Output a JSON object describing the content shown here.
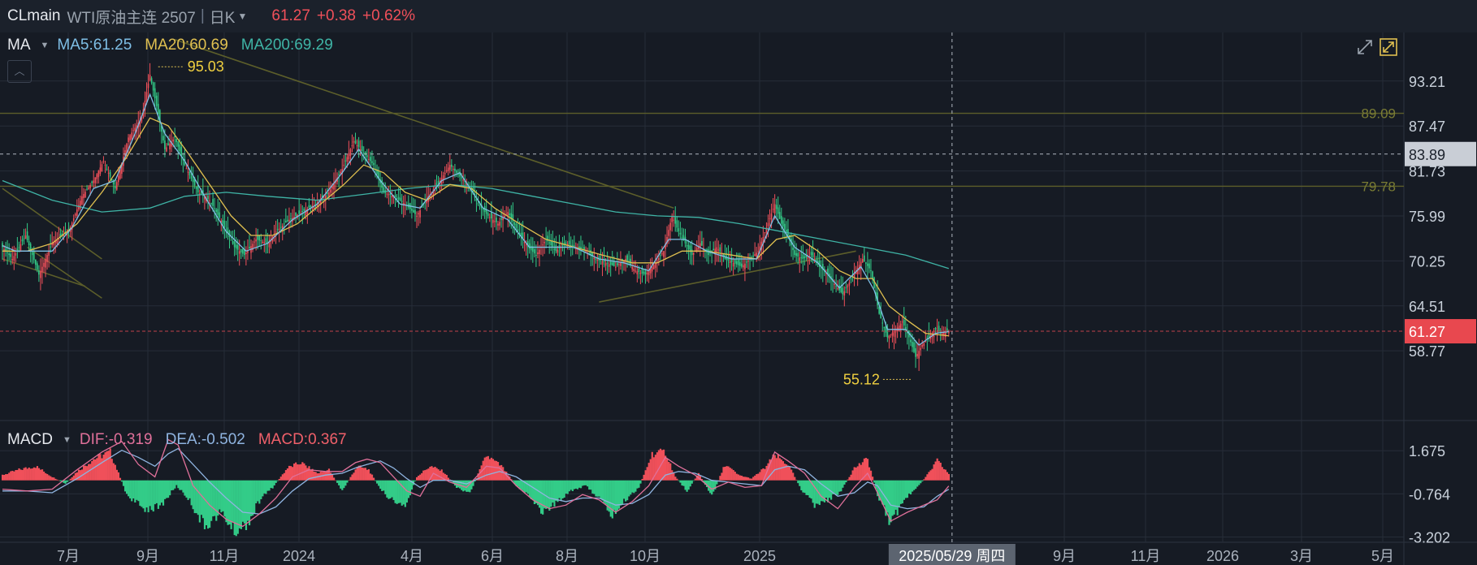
{
  "header": {
    "symbol": "CLmain",
    "name": "WTI原油主连 2507",
    "period": "日K",
    "price": "61.27",
    "change": "+0.38",
    "change_pct": "+0.62%"
  },
  "main_legend": {
    "label": "MA",
    "ma5": "MA5:61.25",
    "ma20": "MA20:60.69",
    "ma200": "MA200:69.29"
  },
  "macd_legend": {
    "label": "MACD",
    "dif": "DIF:-0.319",
    "dea": "DEA:-0.502",
    "macd": "MACD:0.367"
  },
  "colors": {
    "up": "#f0505a",
    "down": "#33cc88",
    "ma5": "#7fbfe6",
    "ma20": "#e0c050",
    "ma200": "#3fb4a6",
    "dif": "#e0709a",
    "dea": "#8fb4e0",
    "background": "#161b24"
  },
  "chart_data": {
    "type": "candlestick",
    "price_axis": {
      "ticks": [
        "93.21",
        "87.47",
        "81.73",
        "75.99",
        "70.25",
        "64.51",
        "58.77"
      ]
    },
    "price_range": [
      50.5,
      99.2
    ],
    "current_price_label": "61.27",
    "crosshair_price_label": "83.89",
    "horizontal_levels": [
      {
        "label": "89.09",
        "value": 89.09
      },
      {
        "label": "79.78",
        "value": 79.78
      }
    ],
    "annotations": [
      {
        "label": "95.03",
        "value": 95.03,
        "type": "high"
      },
      {
        "label": "55.12",
        "value": 55.12,
        "type": "low"
      }
    ],
    "time_axis": {
      "labels": [
        "7月",
        "9月",
        "11月",
        "2024",
        "4月",
        "6月",
        "8月",
        "10月",
        "2025",
        "9月",
        "11月",
        "2026",
        "3月",
        "5月"
      ],
      "crosshair_date": "2025/05/29 周四"
    },
    "macd_axis": {
      "ticks": [
        "1.675",
        "-0.764",
        "-3.202"
      ],
      "range": [
        -3.5,
        3.2
      ]
    },
    "close_path": [
      [
        0,
        72.0
      ],
      [
        6,
        70.5
      ],
      [
        14,
        73.5
      ],
      [
        22,
        68.5
      ],
      [
        30,
        72.5
      ],
      [
        40,
        74.0
      ],
      [
        48,
        78.5
      ],
      [
        55,
        80.5
      ],
      [
        61,
        83.0
      ],
      [
        68,
        79.5
      ],
      [
        76,
        86.0
      ],
      [
        84,
        88.5
      ],
      [
        89,
        94.0
      ],
      [
        94,
        89.0
      ],
      [
        98,
        84.5
      ],
      [
        104,
        86.0
      ],
      [
        110,
        82.5
      ],
      [
        118,
        79.0
      ],
      [
        125,
        78.0
      ],
      [
        133,
        75.0
      ],
      [
        140,
        72.0
      ],
      [
        146,
        71.0
      ],
      [
        153,
        73.0
      ],
      [
        160,
        72.5
      ],
      [
        165,
        74.0
      ],
      [
        173,
        75.5
      ],
      [
        181,
        76.5
      ],
      [
        189,
        77.5
      ],
      [
        197,
        79.0
      ],
      [
        205,
        82.0
      ],
      [
        212,
        85.5
      ],
      [
        218,
        84.0
      ],
      [
        224,
        82.5
      ],
      [
        230,
        79.0
      ],
      [
        236,
        78.5
      ],
      [
        243,
        77.5
      ],
      [
        250,
        76.0
      ],
      [
        257,
        78.5
      ],
      [
        264,
        80.5
      ],
      [
        270,
        82.5
      ],
      [
        276,
        81.0
      ],
      [
        281,
        80.0
      ],
      [
        287,
        77.5
      ],
      [
        293,
        76.0
      ],
      [
        299,
        75.0
      ],
      [
        305,
        76.5
      ],
      [
        311,
        74.0
      ],
      [
        317,
        72.0
      ],
      [
        322,
        71.0
      ],
      [
        328,
        73.0
      ],
      [
        334,
        71.5
      ],
      [
        340,
        72.5
      ],
      [
        346,
        72.0
      ],
      [
        352,
        71.5
      ],
      [
        358,
        70.5
      ],
      [
        364,
        70.0
      ],
      [
        370,
        69.5
      ],
      [
        376,
        70.5
      ],
      [
        382,
        69.0
      ],
      [
        388,
        68.5
      ],
      [
        394,
        70.0
      ],
      [
        399,
        71.5
      ],
      [
        404,
        76.0
      ],
      [
        408,
        74.0
      ],
      [
        412,
        72.5
      ],
      [
        416,
        71.0
      ],
      [
        421,
        72.5
      ],
      [
        426,
        71.0
      ],
      [
        431,
        72.0
      ],
      [
        436,
        70.5
      ],
      [
        441,
        70.0
      ],
      [
        446,
        69.5
      ],
      [
        451,
        70.5
      ],
      [
        456,
        71.5
      ],
      [
        461,
        74.5
      ],
      [
        466,
        77.5
      ],
      [
        470,
        75.0
      ],
      [
        474,
        73.5
      ],
      [
        478,
        71.0
      ],
      [
        483,
        70.5
      ],
      [
        488,
        71.0
      ],
      [
        493,
        69.5
      ],
      [
        498,
        68.5
      ],
      [
        503,
        67.0
      ],
      [
        507,
        66.0
      ],
      [
        511,
        67.5
      ],
      [
        515,
        69.0
      ],
      [
        519,
        70.5
      ],
      [
        524,
        69.0
      ],
      [
        529,
        63.5
      ],
      [
        534,
        60.5
      ],
      [
        539,
        61.5
      ],
      [
        543,
        62.5
      ],
      [
        547,
        60.5
      ],
      [
        551,
        58.0
      ],
      [
        555,
        59.5
      ],
      [
        559,
        60.5
      ],
      [
        563,
        61.5
      ],
      [
        567,
        61.0
      ],
      [
        571,
        61.27
      ]
    ],
    "ma5_path": [
      [
        0,
        72.2
      ],
      [
        8,
        71.5
      ],
      [
        18,
        71.5
      ],
      [
        30,
        71.5
      ],
      [
        42,
        74.5
      ],
      [
        55,
        79.5
      ],
      [
        68,
        80.5
      ],
      [
        80,
        86.5
      ],
      [
        89,
        91.5
      ],
      [
        98,
        86.5
      ],
      [
        110,
        83.0
      ],
      [
        122,
        78.5
      ],
      [
        135,
        74.0
      ],
      [
        147,
        71.5
      ],
      [
        160,
        72.5
      ],
      [
        175,
        75.5
      ],
      [
        190,
        77.5
      ],
      [
        205,
        81.5
      ],
      [
        215,
        84.5
      ],
      [
        228,
        80.5
      ],
      [
        240,
        77.5
      ],
      [
        252,
        77.0
      ],
      [
        265,
        80.5
      ],
      [
        276,
        81.5
      ],
      [
        290,
        77.0
      ],
      [
        305,
        75.5
      ],
      [
        318,
        72.0
      ],
      [
        330,
        72.0
      ],
      [
        345,
        72.0
      ],
      [
        360,
        70.5
      ],
      [
        375,
        70.0
      ],
      [
        390,
        69.0
      ],
      [
        402,
        73.0
      ],
      [
        412,
        73.0
      ],
      [
        425,
        71.5
      ],
      [
        440,
        70.5
      ],
      [
        455,
        70.5
      ],
      [
        466,
        76.0
      ],
      [
        478,
        72.0
      ],
      [
        492,
        70.0
      ],
      [
        505,
        66.8
      ],
      [
        518,
        69.5
      ],
      [
        526,
        66.5
      ],
      [
        534,
        61.5
      ],
      [
        545,
        61.5
      ],
      [
        553,
        59.5
      ],
      [
        563,
        61.0
      ],
      [
        571,
        61.25
      ]
    ],
    "ma20_path": [
      [
        0,
        71.5
      ],
      [
        15,
        71.5
      ],
      [
        30,
        72.5
      ],
      [
        45,
        75.0
      ],
      [
        60,
        79.0
      ],
      [
        75,
        83.5
      ],
      [
        89,
        88.5
      ],
      [
        100,
        87.5
      ],
      [
        112,
        84.0
      ],
      [
        125,
        80.0
      ],
      [
        138,
        76.0
      ],
      [
        150,
        73.5
      ],
      [
        163,
        73.5
      ],
      [
        178,
        75.0
      ],
      [
        192,
        77.5
      ],
      [
        206,
        80.0
      ],
      [
        218,
        82.5
      ],
      [
        230,
        81.5
      ],
      [
        243,
        79.0
      ],
      [
        256,
        78.0
      ],
      [
        270,
        80.0
      ],
      [
        283,
        79.5
      ],
      [
        297,
        77.0
      ],
      [
        312,
        75.0
      ],
      [
        328,
        73.0
      ],
      [
        345,
        72.0
      ],
      [
        362,
        71.0
      ],
      [
        380,
        70.0
      ],
      [
        395,
        70.0
      ],
      [
        410,
        71.5
      ],
      [
        425,
        71.5
      ],
      [
        440,
        71.0
      ],
      [
        455,
        70.5
      ],
      [
        467,
        73.0
      ],
      [
        478,
        73.5
      ],
      [
        492,
        71.5
      ],
      [
        505,
        69.0
      ],
      [
        515,
        68.0
      ],
      [
        525,
        68.0
      ],
      [
        535,
        64.5
      ],
      [
        547,
        62.5
      ],
      [
        557,
        61.0
      ],
      [
        566,
        60.8
      ],
      [
        571,
        60.69
      ]
    ],
    "ma200_path": [
      [
        0,
        80.5
      ],
      [
        30,
        78.0
      ],
      [
        60,
        76.5
      ],
      [
        89,
        77.0
      ],
      [
        110,
        78.5
      ],
      [
        135,
        79.0
      ],
      [
        160,
        78.5
      ],
      [
        190,
        78.0
      ],
      [
        220,
        78.8
      ],
      [
        245,
        79.5
      ],
      [
        270,
        80.0
      ],
      [
        295,
        79.5
      ],
      [
        320,
        78.5
      ],
      [
        345,
        77.5
      ],
      [
        370,
        76.5
      ],
      [
        395,
        76.0
      ],
      [
        420,
        75.8
      ],
      [
        445,
        75.0
      ],
      [
        470,
        74.0
      ],
      [
        495,
        73.0
      ],
      [
        520,
        72.0
      ],
      [
        545,
        71.0
      ],
      [
        560,
        70.0
      ],
      [
        571,
        69.29
      ]
    ],
    "trend_lines": [
      {
        "from": [
          104,
          98.5
        ],
        "to": [
          405,
          77.0
        ]
      },
      {
        "from": [
          0,
          79.5
        ],
        "to": [
          60,
          70.5
        ]
      },
      {
        "from": [
          360,
          65.0
        ],
        "to": [
          515,
          71.5
        ]
      },
      {
        "from": [
          15,
          72.0
        ],
        "to": [
          60,
          65.5
        ]
      },
      {
        "from": [
          0,
          70.5
        ],
        "to": [
          50,
          67.0
        ]
      }
    ],
    "macd_hist_path": [
      [
        0,
        0.3
      ],
      [
        10,
        0.6
      ],
      [
        20,
        0.8
      ],
      [
        30,
        0.2
      ],
      [
        38,
        -0.2
      ],
      [
        45,
        0.5
      ],
      [
        55,
        1.2
      ],
      [
        65,
        1.6
      ],
      [
        75,
        -0.8
      ],
      [
        85,
        -1.6
      ],
      [
        95,
        -1.5
      ],
      [
        105,
        -0.3
      ],
      [
        112,
        -1.0
      ],
      [
        122,
        -2.6
      ],
      [
        132,
        -1.8
      ],
      [
        140,
        -2.9
      ],
      [
        148,
        -2.4
      ],
      [
        156,
        -1.0
      ],
      [
        163,
        -0.4
      ],
      [
        172,
        0.7
      ],
      [
        180,
        1.0
      ],
      [
        190,
        0.4
      ],
      [
        197,
        0.6
      ],
      [
        205,
        -0.6
      ],
      [
        214,
        0.8
      ],
      [
        221,
        0.6
      ],
      [
        228,
        -0.5
      ],
      [
        236,
        -1.2
      ],
      [
        243,
        -1.5
      ],
      [
        250,
        0.2
      ],
      [
        258,
        0.8
      ],
      [
        266,
        0.5
      ],
      [
        274,
        -0.4
      ],
      [
        282,
        -0.7
      ],
      [
        292,
        1.4
      ],
      [
        301,
        0.8
      ],
      [
        310,
        -0.3
      ],
      [
        318,
        -0.9
      ],
      [
        326,
        -1.8
      ],
      [
        334,
        -1.3
      ],
      [
        342,
        -0.6
      ],
      [
        352,
        -0.3
      ],
      [
        360,
        -1.0
      ],
      [
        368,
        -2.0
      ],
      [
        376,
        -1.1
      ],
      [
        384,
        -0.4
      ],
      [
        392,
        1.5
      ],
      [
        400,
        1.6
      ],
      [
        406,
        0.2
      ],
      [
        413,
        -0.6
      ],
      [
        420,
        0.4
      ],
      [
        428,
        -0.9
      ],
      [
        436,
        0.9
      ],
      [
        444,
        0.3
      ],
      [
        452,
        0.1
      ],
      [
        460,
        0.7
      ],
      [
        466,
        1.4
      ],
      [
        474,
        0.9
      ],
      [
        482,
        -0.5
      ],
      [
        490,
        -1.4
      ],
      [
        498,
        -1.1
      ],
      [
        506,
        -0.6
      ],
      [
        514,
        0.7
      ],
      [
        522,
        1.2
      ],
      [
        528,
        -0.8
      ],
      [
        536,
        -2.4
      ],
      [
        544,
        -1.1
      ],
      [
        552,
        -0.4
      ],
      [
        558,
        0.3
      ],
      [
        564,
        1.1
      ],
      [
        571,
        0.367
      ]
    ],
    "dif_path": [
      [
        0,
        -0.5
      ],
      [
        15,
        -0.6
      ],
      [
        30,
        -0.5
      ],
      [
        45,
        0.6
      ],
      [
        60,
        1.6
      ],
      [
        72,
        2.2
      ],
      [
        82,
        0.9
      ],
      [
        92,
        0.2
      ],
      [
        100,
        2.3
      ],
      [
        106,
        2.0
      ],
      [
        115,
        -0.3
      ],
      [
        125,
        -1.4
      ],
      [
        135,
        -2.2
      ],
      [
        145,
        -2.6
      ],
      [
        155,
        -1.9
      ],
      [
        165,
        -1.0
      ],
      [
        175,
        0.2
      ],
      [
        185,
        0.6
      ],
      [
        195,
        0.5
      ],
      [
        205,
        0.5
      ],
      [
        213,
        1.0
      ],
      [
        220,
        1.2
      ],
      [
        228,
        1.0
      ],
      [
        236,
        0.2
      ],
      [
        244,
        -0.6
      ],
      [
        252,
        -0.9
      ],
      [
        260,
        0.4
      ],
      [
        270,
        -0.1
      ],
      [
        280,
        -0.4
      ],
      [
        292,
        0.8
      ],
      [
        300,
        0.7
      ],
      [
        310,
        -0.3
      ],
      [
        320,
        -1.1
      ],
      [
        330,
        -1.6
      ],
      [
        340,
        -1.4
      ],
      [
        350,
        -0.8
      ],
      [
        360,
        -1.1
      ],
      [
        370,
        -1.8
      ],
      [
        380,
        -1.2
      ],
      [
        390,
        -0.3
      ],
      [
        400,
        1.3
      ],
      [
        408,
        0.8
      ],
      [
        418,
        0.3
      ],
      [
        428,
        -0.5
      ],
      [
        438,
        -0.1
      ],
      [
        448,
        -0.4
      ],
      [
        458,
        -0.3
      ],
      [
        466,
        1.6
      ],
      [
        474,
        1.1
      ],
      [
        484,
        0.4
      ],
      [
        494,
        -0.9
      ],
      [
        504,
        -1.6
      ],
      [
        514,
        -0.4
      ],
      [
        522,
        0.4
      ],
      [
        528,
        -0.7
      ],
      [
        536,
        -2.3
      ],
      [
        546,
        -1.8
      ],
      [
        556,
        -1.4
      ],
      [
        564,
        -1.1
      ],
      [
        571,
        -0.319
      ]
    ],
    "dea_path": [
      [
        0,
        -0.6
      ],
      [
        15,
        -0.6
      ],
      [
        30,
        -0.7
      ],
      [
        45,
        0.1
      ],
      [
        60,
        1.0
      ],
      [
        72,
        1.7
      ],
      [
        82,
        1.3
      ],
      [
        92,
        0.8
      ],
      [
        100,
        1.5
      ],
      [
        106,
        1.8
      ],
      [
        115,
        0.9
      ],
      [
        125,
        -0.1
      ],
      [
        135,
        -1.0
      ],
      [
        145,
        -1.8
      ],
      [
        155,
        -1.9
      ],
      [
        165,
        -1.5
      ],
      [
        175,
        -0.6
      ],
      [
        185,
        0.1
      ],
      [
        195,
        0.3
      ],
      [
        205,
        0.4
      ],
      [
        213,
        0.7
      ],
      [
        220,
        0.9
      ],
      [
        228,
        1.1
      ],
      [
        236,
        0.7
      ],
      [
        244,
        0.1
      ],
      [
        252,
        -0.4
      ],
      [
        260,
        0.0
      ],
      [
        270,
        0.0
      ],
      [
        280,
        -0.2
      ],
      [
        292,
        0.3
      ],
      [
        300,
        0.5
      ],
      [
        310,
        0.2
      ],
      [
        320,
        -0.4
      ],
      [
        330,
        -1.0
      ],
      [
        340,
        -1.2
      ],
      [
        350,
        -1.0
      ],
      [
        360,
        -1.0
      ],
      [
        370,
        -1.4
      ],
      [
        380,
        -1.3
      ],
      [
        390,
        -0.8
      ],
      [
        400,
        0.3
      ],
      [
        408,
        0.5
      ],
      [
        418,
        0.4
      ],
      [
        428,
        0.0
      ],
      [
        438,
        -0.1
      ],
      [
        448,
        -0.2
      ],
      [
        458,
        -0.3
      ],
      [
        466,
        0.6
      ],
      [
        474,
        0.8
      ],
      [
        484,
        0.6
      ],
      [
        494,
        -0.2
      ],
      [
        504,
        -0.9
      ],
      [
        514,
        -0.7
      ],
      [
        522,
        -0.1
      ],
      [
        528,
        -0.3
      ],
      [
        536,
        -1.4
      ],
      [
        546,
        -1.6
      ],
      [
        556,
        -1.5
      ],
      [
        564,
        -0.9
      ],
      [
        571,
        -0.502
      ]
    ]
  }
}
